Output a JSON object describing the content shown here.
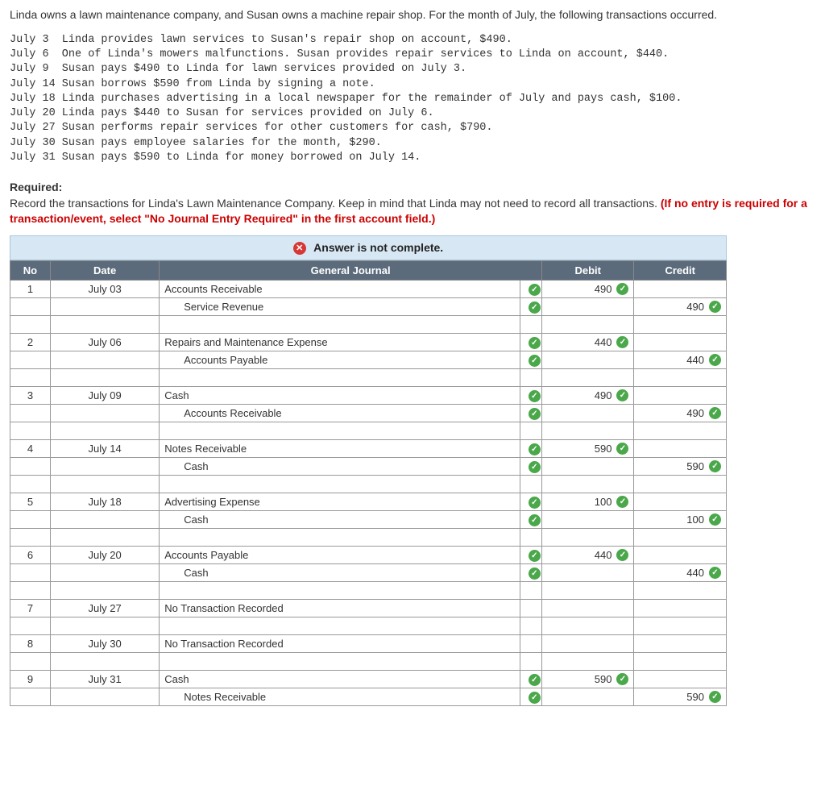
{
  "intro": "Linda owns a lawn maintenance company, and Susan owns a machine repair shop. For the month of July, the following transactions occurred.",
  "transactions": [
    "July 3  Linda provides lawn services to Susan's repair shop on account, $490.",
    "July 6  One of Linda's mowers malfunctions. Susan provides repair services to Linda on account, $440.",
    "July 9  Susan pays $490 to Linda for lawn services provided on July 3.",
    "July 14 Susan borrows $590 from Linda by signing a note.",
    "July 18 Linda purchases advertising in a local newspaper for the remainder of July and pays cash, $100.",
    "July 20 Linda pays $440 to Susan for services provided on July 6.",
    "July 27 Susan performs repair services for other customers for cash, $790.",
    "July 30 Susan pays employee salaries for the month, $290.",
    "July 31 Susan pays $590 to Linda for money borrowed on July 14."
  ],
  "required": {
    "label": "Required:",
    "text": "Record the transactions for Linda's Lawn Maintenance Company. Keep in mind that Linda may not need to record all transactions. ",
    "hint": "(If no entry is required for a transaction/event, select \"No Journal Entry Required\" in the first account field.)"
  },
  "banner": "Answer is not complete.",
  "headers": {
    "no": "No",
    "date": "Date",
    "journal": "General Journal",
    "debit": "Debit",
    "credit": "Credit"
  },
  "entries": [
    {
      "no": "1",
      "date": "July 03",
      "lines": [
        {
          "acct": "Accounts Receivable",
          "indent": false,
          "chk": true,
          "debit": "490",
          "dchk": true,
          "credit": "",
          "cchk": false
        },
        {
          "acct": "Service Revenue",
          "indent": true,
          "chk": true,
          "debit": "",
          "dchk": false,
          "credit": "490",
          "cchk": true
        }
      ]
    },
    {
      "no": "2",
      "date": "July 06",
      "lines": [
        {
          "acct": "Repairs and Maintenance Expense",
          "indent": false,
          "chk": true,
          "debit": "440",
          "dchk": true,
          "credit": "",
          "cchk": false
        },
        {
          "acct": "Accounts Payable",
          "indent": true,
          "chk": true,
          "debit": "",
          "dchk": false,
          "credit": "440",
          "cchk": true
        }
      ]
    },
    {
      "no": "3",
      "date": "July 09",
      "lines": [
        {
          "acct": "Cash",
          "indent": false,
          "chk": true,
          "debit": "490",
          "dchk": true,
          "credit": "",
          "cchk": false
        },
        {
          "acct": "Accounts Receivable",
          "indent": true,
          "chk": true,
          "debit": "",
          "dchk": false,
          "credit": "490",
          "cchk": true
        }
      ]
    },
    {
      "no": "4",
      "date": "July 14",
      "lines": [
        {
          "acct": "Notes Receivable",
          "indent": false,
          "chk": true,
          "debit": "590",
          "dchk": true,
          "credit": "",
          "cchk": false
        },
        {
          "acct": "Cash",
          "indent": true,
          "chk": true,
          "debit": "",
          "dchk": false,
          "credit": "590",
          "cchk": true
        }
      ]
    },
    {
      "no": "5",
      "date": "July 18",
      "lines": [
        {
          "acct": "Advertising Expense",
          "indent": false,
          "chk": true,
          "debit": "100",
          "dchk": true,
          "credit": "",
          "cchk": false
        },
        {
          "acct": "Cash",
          "indent": true,
          "chk": true,
          "debit": "",
          "dchk": false,
          "credit": "100",
          "cchk": true
        }
      ]
    },
    {
      "no": "6",
      "date": "July 20",
      "lines": [
        {
          "acct": "Accounts Payable",
          "indent": false,
          "chk": true,
          "debit": "440",
          "dchk": true,
          "credit": "",
          "cchk": false
        },
        {
          "acct": "Cash",
          "indent": true,
          "chk": true,
          "debit": "",
          "dchk": false,
          "credit": "440",
          "cchk": true
        }
      ]
    },
    {
      "no": "7",
      "date": "July 27",
      "lines": [
        {
          "acct": "No Transaction Recorded",
          "indent": false,
          "chk": false,
          "debit": "",
          "dchk": false,
          "credit": "",
          "cchk": false
        }
      ]
    },
    {
      "no": "8",
      "date": "July 30",
      "lines": [
        {
          "acct": "No Transaction Recorded",
          "indent": false,
          "chk": false,
          "debit": "",
          "dchk": false,
          "credit": "",
          "cchk": false
        }
      ]
    },
    {
      "no": "9",
      "date": "July 31",
      "lines": [
        {
          "acct": "Cash",
          "indent": false,
          "chk": true,
          "debit": "590",
          "dchk": true,
          "credit": "",
          "cchk": false
        },
        {
          "acct": "Notes Receivable",
          "indent": true,
          "chk": true,
          "debit": "",
          "dchk": false,
          "credit": "590",
          "cchk": true
        }
      ]
    }
  ]
}
